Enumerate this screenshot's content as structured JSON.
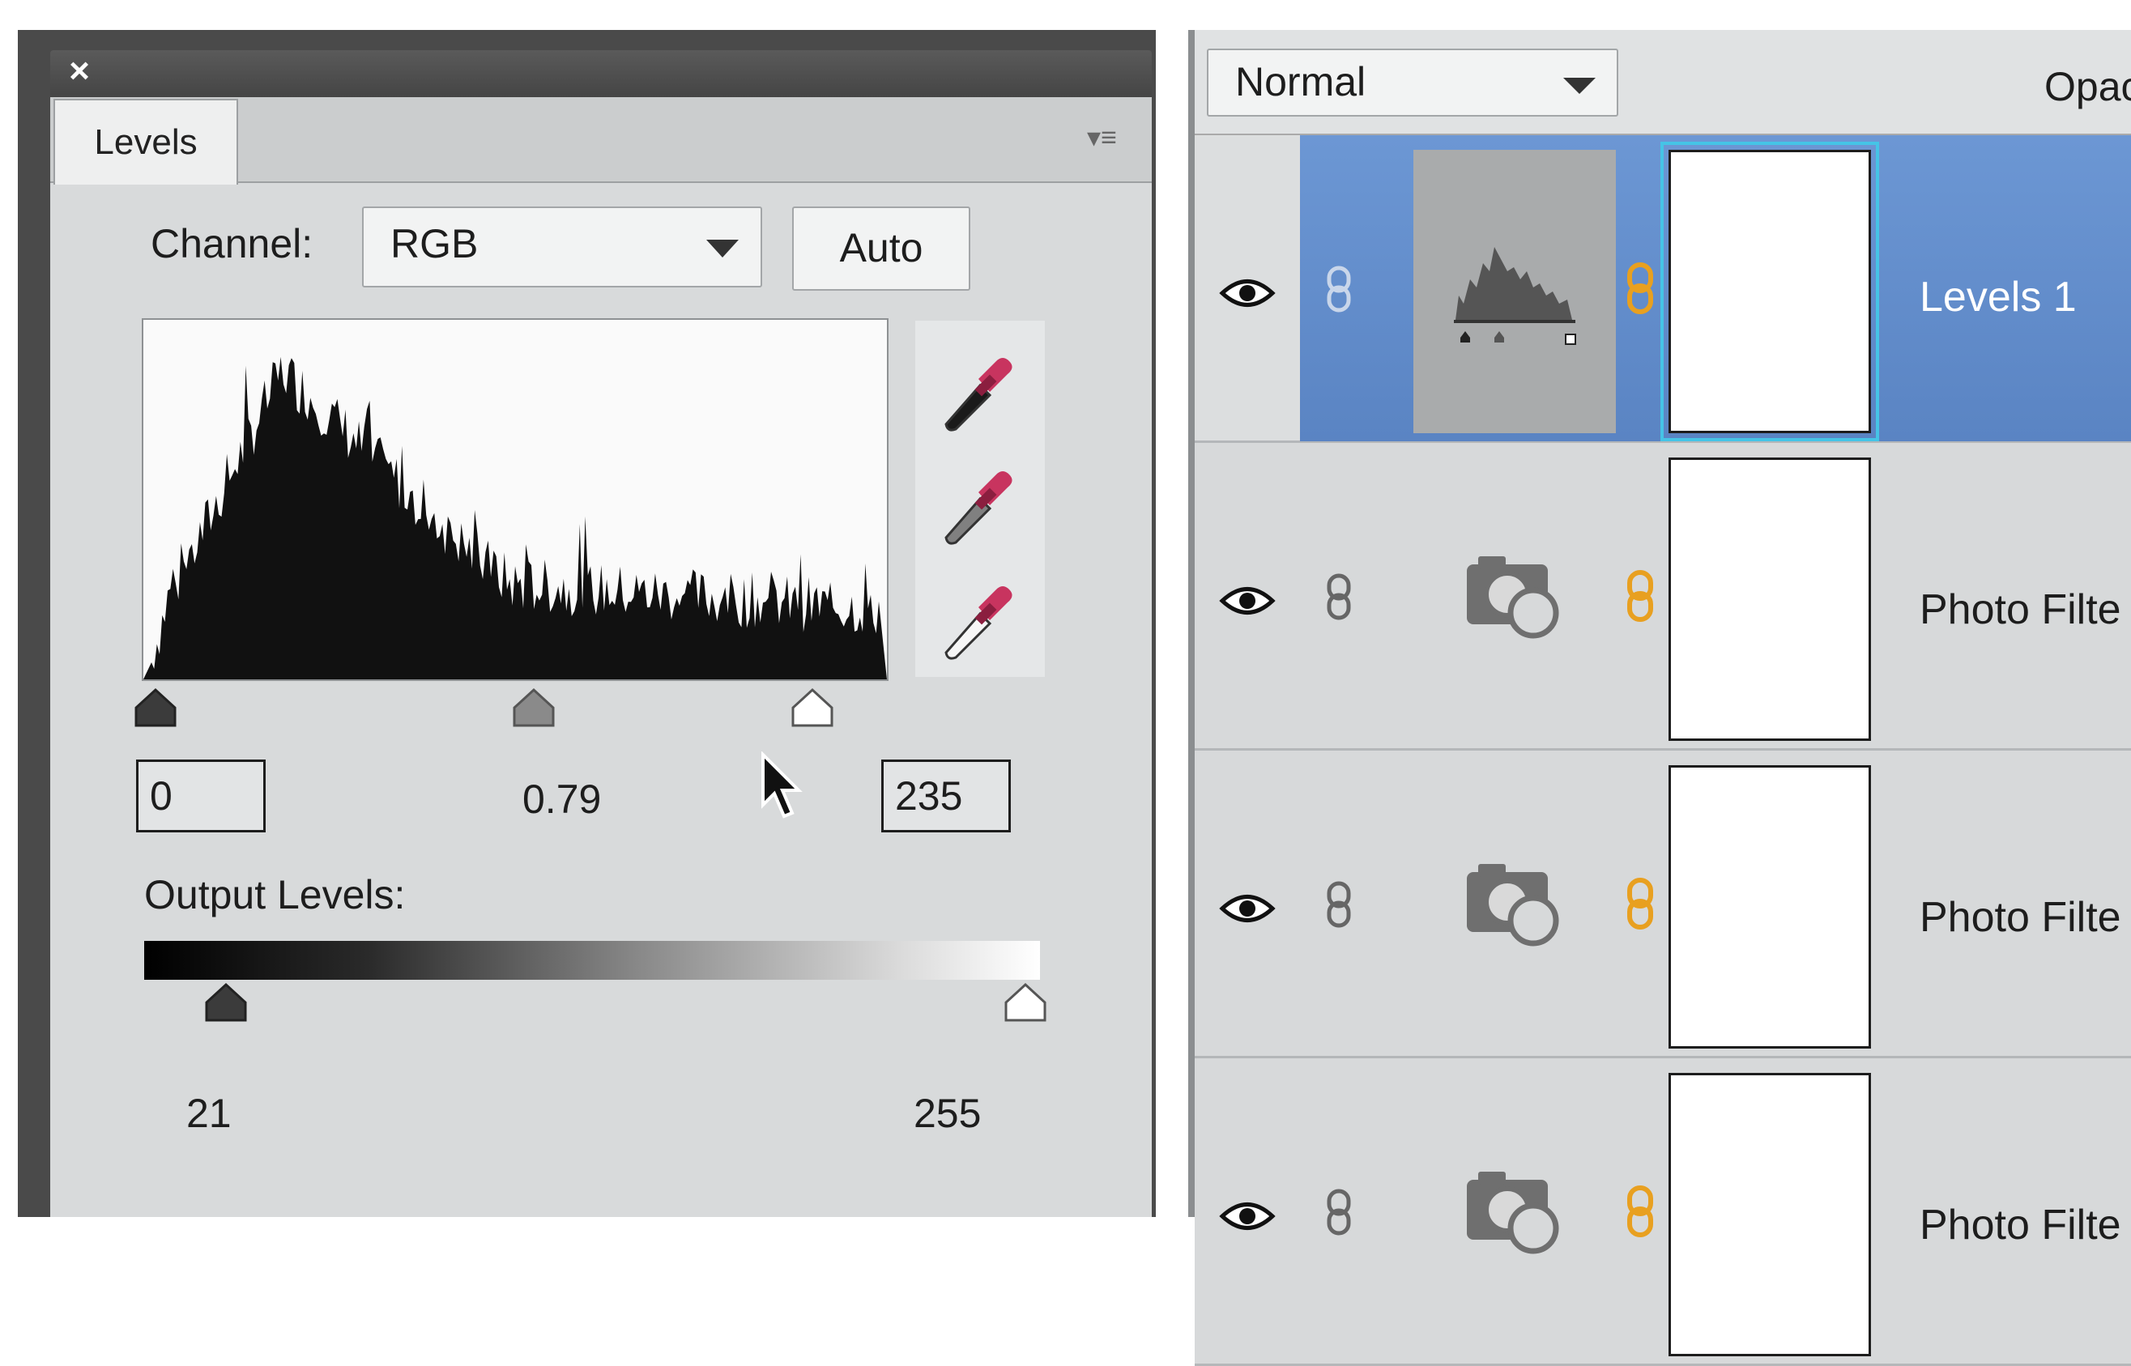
{
  "levels_panel": {
    "close_icon": "×",
    "tab_label": "Levels",
    "menu_icon": "▾≡",
    "channel_label": "Channel:",
    "channel_value": "RGB",
    "auto_label": "Auto",
    "input_black": "0",
    "input_gamma": "0.79",
    "input_white": "235",
    "output_label": "Output Levels:",
    "output_black": "21",
    "output_white": "255",
    "eyedroppers": [
      "black-point-eyedropper",
      "gray-point-eyedropper",
      "white-point-eyedropper"
    ]
  },
  "layers_panel": {
    "blend_mode": "Normal",
    "opacity_label": "Opac",
    "layers": [
      {
        "name": "Levels 1",
        "type": "levels",
        "selected": true
      },
      {
        "name": "Photo Filte",
        "type": "photo-filter",
        "selected": false
      },
      {
        "name": "Photo Filte",
        "type": "photo-filter",
        "selected": false
      },
      {
        "name": "Photo Filte",
        "type": "photo-filter",
        "selected": false
      }
    ]
  },
  "colors": {
    "selected_layer": "#5f8bcb",
    "eyedropper_tip": "#c8345f",
    "link_icon": "#e8a020"
  }
}
